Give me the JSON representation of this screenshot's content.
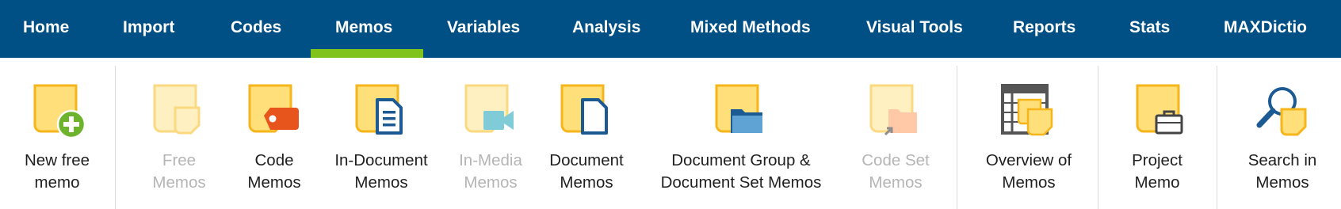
{
  "menu": {
    "tabs": [
      {
        "label": "Home"
      },
      {
        "label": "Import"
      },
      {
        "label": "Codes"
      },
      {
        "label": "Memos"
      },
      {
        "label": "Variables"
      },
      {
        "label": "Analysis"
      },
      {
        "label": "Mixed Methods"
      },
      {
        "label": "Visual Tools"
      },
      {
        "label": "Reports"
      },
      {
        "label": "Stats"
      },
      {
        "label": "MAXDictio"
      }
    ],
    "active_tab": "Memos"
  },
  "ribbon": {
    "buttons": [
      {
        "line1": "New free",
        "line2": "memo",
        "icon": "new-memo-plus-icon",
        "enabled": true
      },
      {
        "line1": "Free",
        "line2": "Memos",
        "icon": "free-memos-icon",
        "enabled": false
      },
      {
        "line1": "Code",
        "line2": "Memos",
        "icon": "code-memo-tag-icon",
        "enabled": true
      },
      {
        "line1": "In-Document",
        "line2": "Memos",
        "icon": "in-document-memo-icon",
        "enabled": true
      },
      {
        "line1": "In-Media",
        "line2": "Memos",
        "icon": "in-media-memo-camera-icon",
        "enabled": false
      },
      {
        "line1": "Document",
        "line2": "Memos",
        "icon": "document-memo-icon",
        "enabled": true
      },
      {
        "line1": "Document Group &",
        "line2": "Document Set Memos",
        "icon": "document-group-folder-icon",
        "enabled": true
      },
      {
        "line1": "Code Set",
        "line2": "Memos",
        "icon": "code-set-memo-icon",
        "enabled": false
      },
      {
        "line1": "Overview of",
        "line2": "Memos",
        "icon": "overview-table-icon",
        "enabled": true
      },
      {
        "line1": "Project",
        "line2": "Memo",
        "icon": "project-briefcase-icon",
        "enabled": true
      },
      {
        "line1": "Search in",
        "line2": "Memos",
        "icon": "search-magnifier-icon",
        "enabled": true
      }
    ]
  },
  "colors": {
    "menubar_bg": "#005086",
    "active_underline": "#7fc31c",
    "memo_yellow": "#ffdf7a",
    "memo_border": "#f6b51b",
    "accent_blue": "#1c5a93",
    "tag_orange": "#e8551c",
    "plus_green": "#6db32c",
    "disabled_text": "#b5b5b5"
  }
}
